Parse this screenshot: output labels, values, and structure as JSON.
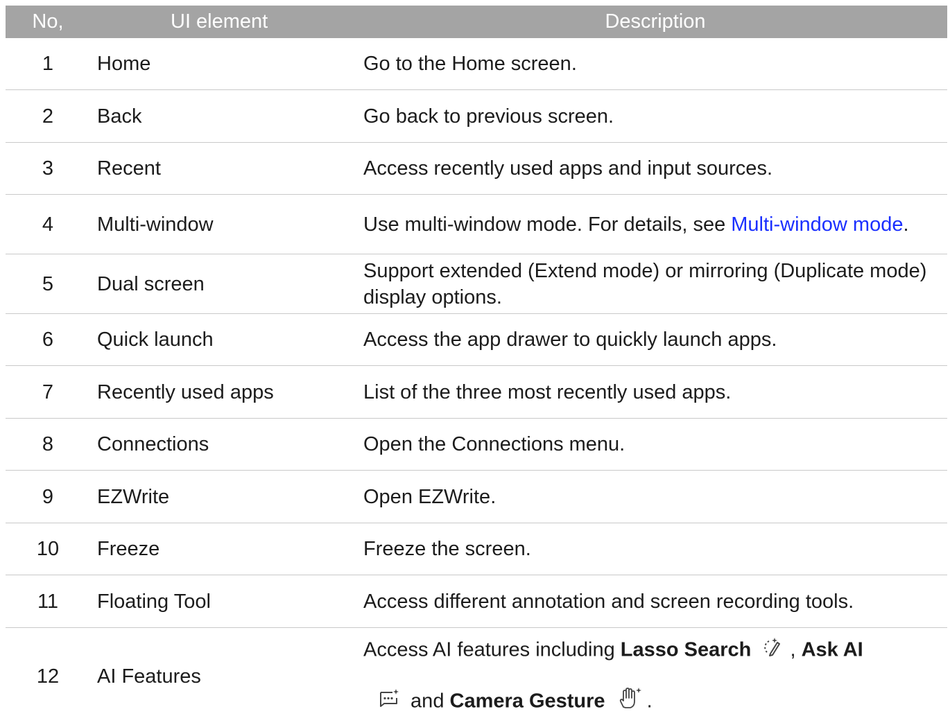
{
  "header": {
    "no": "No,",
    "ui": "UI element",
    "desc": "Description"
  },
  "rows": [
    {
      "no": "1",
      "ui": "Home",
      "desc": "Go to the Home screen."
    },
    {
      "no": "2",
      "ui": "Back",
      "desc": "Go back to previous screen."
    },
    {
      "no": "3",
      "ui": "Recent",
      "desc": "Access recently used apps and input sources."
    },
    {
      "no": "4",
      "ui": "Multi-window",
      "desc_prefix": "Use multi-window mode. For details, see ",
      "desc_link": "Multi-window mode",
      "desc_suffix": "."
    },
    {
      "no": "5",
      "ui": "Dual screen",
      "desc": "Support extended (Extend mode) or mirroring (Duplicate mode) display options."
    },
    {
      "no": "6",
      "ui": "Quick launch",
      "desc": "Access the app drawer to quickly launch apps."
    },
    {
      "no": "7",
      "ui": "Recently used apps",
      "desc": "List of the three most recently used apps."
    },
    {
      "no": "8",
      "ui": "Connections",
      "desc": "Open the Connections menu."
    },
    {
      "no": "9",
      "ui": "EZWrite",
      "desc": "Open EZWrite."
    },
    {
      "no": "10",
      "ui": "Freeze",
      "desc": "Freeze the screen."
    },
    {
      "no": "11",
      "ui": "Floating Tool",
      "desc": "Access different annotation and screen recording tools."
    },
    {
      "no": "12",
      "ui": "AI Features",
      "desc_intro": "Access AI features including ",
      "lasso": "Lasso Search",
      "sep1": ", ",
      "askai": "Ask AI",
      "and": " and ",
      "camera": "Camera Gesture",
      "end": "."
    }
  ],
  "icons": {
    "lasso": "lasso-pen-icon",
    "askai": "chat-sparkle-icon",
    "camera": "hand-sparkle-icon"
  },
  "colors": {
    "header_bg": "#a4a4a4",
    "link": "#1a2fff",
    "divider": "#c9c9c9"
  }
}
